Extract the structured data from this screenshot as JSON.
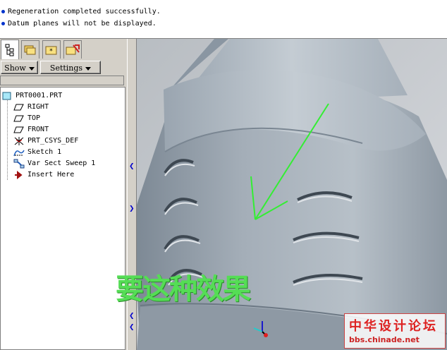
{
  "messages": [
    "Regeneration completed successfully.",
    "Datum planes will not be displayed."
  ],
  "toolbar": {
    "show_label": "Show",
    "settings_label": "Settings"
  },
  "model_tree": {
    "root": "PRT0001.PRT",
    "items": [
      {
        "label": "RIGHT",
        "icon": "datum-plane-icon"
      },
      {
        "label": "TOP",
        "icon": "datum-plane-icon"
      },
      {
        "label": "FRONT",
        "icon": "datum-plane-icon"
      },
      {
        "label": "PRT_CSYS_DEF",
        "icon": "coordinate-system-icon"
      },
      {
        "label": "Sketch 1",
        "icon": "sketch-icon"
      },
      {
        "label": "Var Sect Sweep 1",
        "icon": "sweep-icon"
      },
      {
        "label": "Insert Here",
        "icon": "insert-arrow-icon"
      }
    ]
  },
  "annotation": {
    "caption": "要这种效果",
    "arrow_color": "#33ee33"
  },
  "watermark": {
    "chinese": "中华设计论坛",
    "url": "bbs.chinade.net"
  },
  "colors": {
    "tree_bg": "#ffffff",
    "panel_bg": "#d4d0c8",
    "model_surface": "#9aa6b2"
  }
}
